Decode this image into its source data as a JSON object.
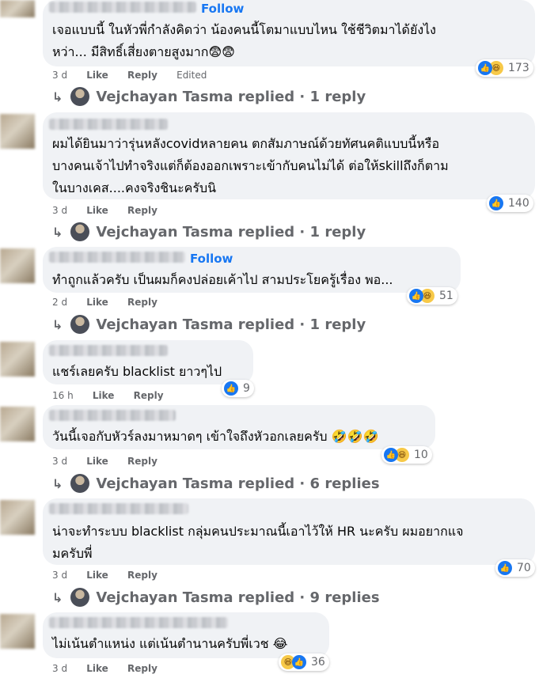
{
  "comments": [
    {
      "follow": "Follow",
      "lines": [
        "เจอแบบนี้ ในหัวพี่กำลังคิดว่า น้องคนนี้โตมาแบบไหน ใช้ชีวิตมาได้ยังไง",
        "หว่า... มีสิทธิ์เสี่ยงตายสูงมาก😨😨"
      ],
      "age": "3 d",
      "like": "Like",
      "reply": "Reply",
      "edited": "Edited",
      "reactions": [
        "like-icon",
        "haha-icon"
      ],
      "count": "173",
      "replies": "Vejchayan Tasma replied · 1 reply"
    },
    {
      "lines": [
        "ผมได้ยินมาว่ารุ่นหลังcovidหลายคน ตกสัมภาษณ์ด้วยทัศนคติแบบนี้หรือ",
        "บางคนเจ้าไปทำจริงแต่ก็ต้องออกเพราะเข้ากับคนไม่ได้ ต่อให้skillถึงก็ตาม",
        "ในบางเคส....คงจริงชินะครับนิ"
      ],
      "age": "3 d",
      "like": "Like",
      "reply": "Reply",
      "reactions": [
        "like-icon"
      ],
      "count": "140",
      "replies": "Vejchayan Tasma replied · 1 reply"
    },
    {
      "follow": "Follow",
      "lines": [
        "ทำถูกแล้วครับ เป็นผมก็คงปล่อยเค้าไป สามประโยครู้เรื่อง พอ..."
      ],
      "age": "2 d",
      "like": "Like",
      "reply": "Reply",
      "reactions": [
        "like-icon",
        "haha-icon"
      ],
      "count": "51",
      "replies": "Vejchayan Tasma replied · 1 reply"
    },
    {
      "lines": [
        "แชร์เลยครับ blacklist ยาวๆไป"
      ],
      "age": "16 h",
      "like": "Like",
      "reply": "Reply",
      "reactions": [
        "like-icon"
      ],
      "count": "9"
    },
    {
      "lines": [
        "วันนี้เจอกับหัวร์ลงมาหมาดๆ เข้าใจถึงหัวอกเลยครับ 🤣🤣🤣"
      ],
      "age": "3 d",
      "like": "Like",
      "reply": "Reply",
      "reactions": [
        "like-icon",
        "haha-icon"
      ],
      "count": "10",
      "replies": "Vejchayan Tasma replied · 6 replies"
    },
    {
      "lines": [
        "น่าจะทำระบบ blacklist กลุ่มคนประมาณนี้เอาไว้ให้ HR นะครับ ผมอยากแจ",
        "มครับพี่"
      ],
      "age": "3 d",
      "like": "Like",
      "reply": "Reply",
      "reactions": [
        "like-icon"
      ],
      "count": "70",
      "replies": "Vejchayan Tasma replied · 9 replies"
    },
    {
      "lines": [
        "ไม่เน้นตำแหน่ง แต่เน้นตำนานครับพี่เวช 😂"
      ],
      "age": "3 d",
      "like": "Like",
      "reply": "Reply",
      "reactions": [
        "haha-icon",
        "like-icon"
      ],
      "count": "36"
    }
  ],
  "colors": {
    "accent": "#1877f2",
    "bubble": "#f0f2f5",
    "meta": "#65676b"
  }
}
